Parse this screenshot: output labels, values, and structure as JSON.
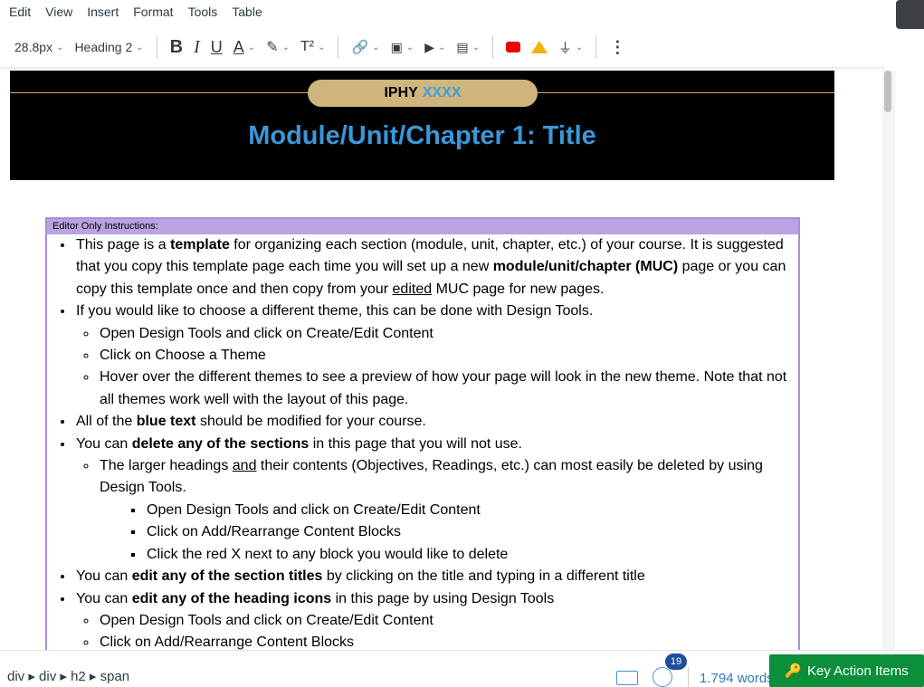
{
  "menu": [
    "Edit",
    "View",
    "Insert",
    "Format",
    "Tools",
    "Table"
  ],
  "toolbar": {
    "font_size": "28.8px",
    "block_style": "Heading 2",
    "bold": "B",
    "italic": "I",
    "underline": "U",
    "text_color": "A",
    "superscript": "T²"
  },
  "banner": {
    "course_prefix": "IPHY",
    "course_number": "XXXX",
    "title": "Module/Unit/Chapter 1: Title"
  },
  "instructions": {
    "heading": "Editor Only Instructions:",
    "items": [
      {
        "pre": "This page is a ",
        "bold": "template",
        "post": " for organizing each section (module, unit, chapter, etc.) of your course.  It is suggested that you copy this template page each time you will set up a new ",
        "bold2": "module/unit/chapter (MUC)",
        "post2": " page or you can copy this template once and then copy from your ",
        "u": "edited",
        "post3": " MUC page for new pages."
      },
      {
        "text": "If you would like to choose a different theme, this can be done with Design Tools."
      },
      {
        "text": "Open Design Tools and click on Create/Edit Content"
      },
      {
        "text": "Click on Choose a Theme"
      },
      {
        "text": "Hover over the different themes to see a preview of how your page will look in the new theme.  Note that not all themes work well with the layout of this page."
      },
      {
        "pre": "All of the ",
        "bold": "blue text",
        "post": " should be modified for your course."
      },
      {
        "pre": "You can ",
        "bold": "delete any of the sections",
        "post": " in this page that you will not use."
      },
      {
        "pre": "The larger headings ",
        "u": "and",
        "post": " their contents (Objectives, Readings, etc.) can most easily be deleted by using Design Tools."
      },
      {
        "text": "Open Design Tools and click on Create/Edit Content"
      },
      {
        "text": "Click on Add/Rearrange Content Blocks"
      },
      {
        "text": "Click the red X next to any block you would like to delete"
      },
      {
        "pre": "You can ",
        "bold": "edit any of the section titles",
        "post": " by clicking on the title and typing in a different title"
      },
      {
        "pre": "You can ",
        "bold": "edit any of the heading icons",
        "post": " in this page by using Design Tools"
      },
      {
        "text": "Open Design Tools and click on Create/Edit Content"
      },
      {
        "text": "Click on Add/Rearrange Content Blocks"
      }
    ]
  },
  "status": {
    "path": "div ▸ div ▸ h2 ▸ span",
    "a11y_count": "19",
    "word_count": "1.794 words",
    "key_action": "Key Action Items"
  }
}
